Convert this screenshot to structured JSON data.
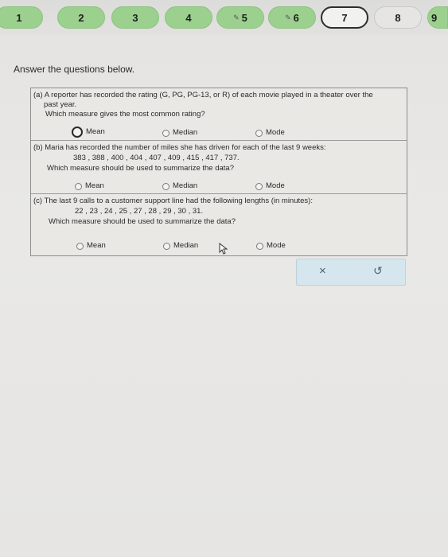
{
  "nav": {
    "questions": [
      {
        "label": "1",
        "state": "done"
      },
      {
        "label": "2",
        "state": "done"
      },
      {
        "label": "3",
        "state": "done"
      },
      {
        "label": "4",
        "state": "done"
      },
      {
        "label": "5",
        "state": "done-edit"
      },
      {
        "label": "6",
        "state": "done-edit"
      },
      {
        "label": "7",
        "state": "current"
      },
      {
        "label": "8",
        "state": "unanswered"
      },
      {
        "label": "9",
        "state": "done"
      }
    ]
  },
  "instructions": "Answer the questions below.",
  "parts": {
    "a": {
      "line1": "(a) A reporter has recorded the rating (G, PG, PG-13, or R) of each movie played in a theater over the",
      "line2": "past year.",
      "prompt": "Which measure gives the most common rating?",
      "options": [
        "Mean",
        "Median",
        "Mode"
      ],
      "selected": "Mean"
    },
    "b": {
      "line1": "(b) Maria has recorded the number of miles she has driven for each of the last 9 weeks:",
      "data": "383 , 388 , 400 , 404 , 407 , 409 , 415 , 417 , 737.",
      "prompt": "Which measure should be used to summarize the data?",
      "options": [
        "Mean",
        "Median",
        "Mode"
      ]
    },
    "c": {
      "line1": "(c) The last 9 calls to a customer support line had the following lengths (in minutes):",
      "data": "22 , 23 , 24 , 25 , 27 , 28 , 29 , 30 , 31.",
      "prompt": "Which measure should be used to summarize the data?",
      "options": [
        "Mean",
        "Median",
        "Mode"
      ]
    }
  },
  "actions": {
    "clear_symbol": "×",
    "undo_symbol": "↺"
  }
}
